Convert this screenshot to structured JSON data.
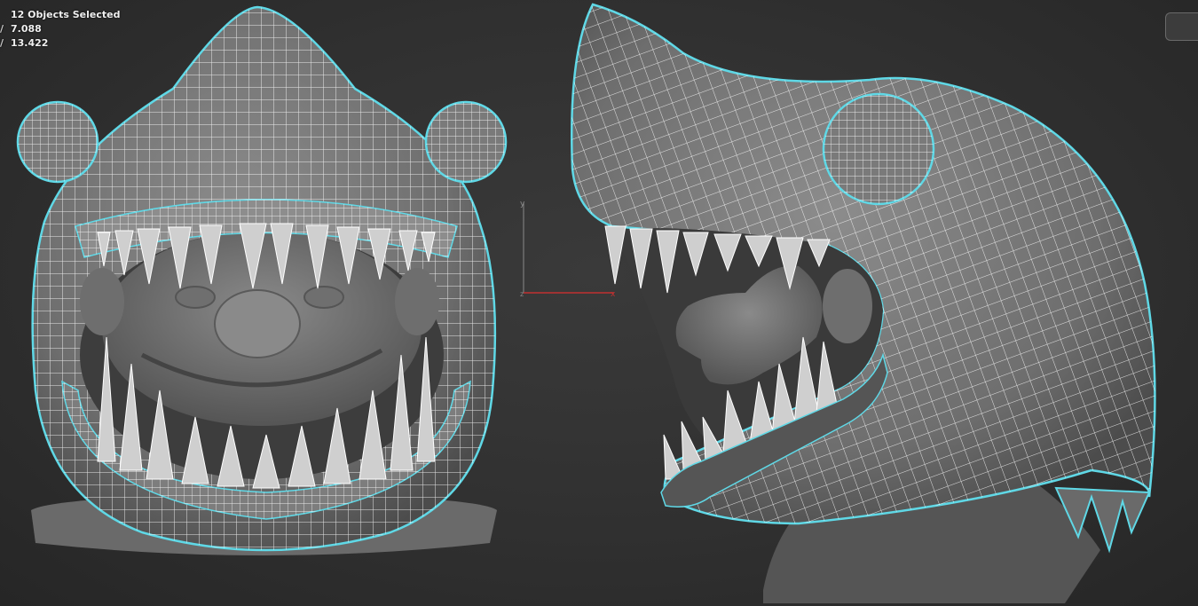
{
  "viewport_stats": {
    "selection": "12 Objects Selected",
    "row1": {
      "label": "/",
      "value": "7.088"
    },
    "row2": {
      "label": "/",
      "value": "13.422"
    }
  },
  "axis_gizmo": {
    "y_label": "y",
    "x_label": "x",
    "z_label": "z"
  },
  "colors": {
    "background": "#303030",
    "selection_outline": "#5fd8e6",
    "wireframe": "#ffffff",
    "mesh": "#7c7c7c",
    "axis_x": "#c03030",
    "axis_y": "#8a8a8a"
  }
}
